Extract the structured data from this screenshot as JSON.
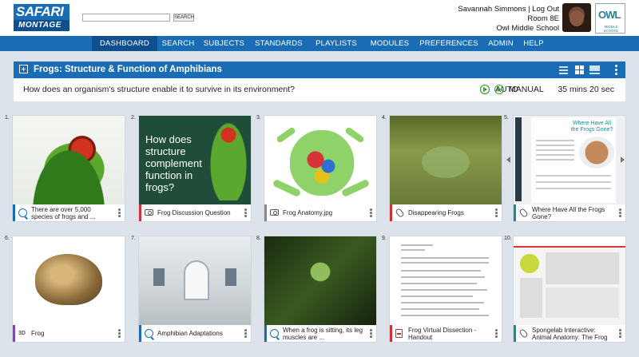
{
  "header": {
    "logo_top": "SAFARI",
    "logo_bottom": "MONTAGE",
    "search_button": "SEARCH",
    "search_placeholder": "",
    "user_line": "Savannah Simmons | Log Out",
    "room": "Room 8E",
    "school": "Owl Middle School",
    "school_logo_main": "OWL",
    "school_logo_sub": "MIDDLE SCHOOL"
  },
  "nav": {
    "items": [
      "DASHBOARD",
      "SEARCH",
      "SUBJECTS",
      "STANDARDS",
      "PLAYLISTS",
      "MODULES",
      "PREFERENCES",
      "ADMIN",
      "HELP"
    ],
    "active": "DASHBOARD"
  },
  "playlist": {
    "title": "Frogs: Structure & Function of Amphibians",
    "question": "How does an organism's structure enable it to survive in its environment?",
    "auto_label": "AUTO",
    "manual_label": "MANUAL",
    "duration": "35 mins 20 sec"
  },
  "cards": [
    {
      "num": "1.",
      "caption": "There are over 5,000 species of frogs and ...",
      "icon": "quiz-icon",
      "color": "#1a6db5"
    },
    {
      "num": "2.",
      "caption": "Frog Discussion Question",
      "icon": "camera-icon",
      "color": "#c33333",
      "thumb_text": "How does structure complement function in frogs?"
    },
    {
      "num": "3.",
      "caption": "Frog Anatomy.jpg",
      "icon": "camera-icon",
      "color": "#888888"
    },
    {
      "num": "4.",
      "caption": "Disappearing Frogs",
      "icon": "link-icon",
      "color": "#c33333"
    },
    {
      "num": "5.",
      "caption": "Where Have All the Frogs Gone?",
      "icon": "link-icon",
      "color": "#1a8aa0",
      "thumb_text": "Where Have All the Frogs Gone?"
    },
    {
      "num": "6.",
      "caption": "Frog",
      "icon": "3d-icon",
      "color": "#7b4aa8"
    },
    {
      "num": "7.",
      "caption": "Amphibian Adaptations",
      "icon": "quiz-icon",
      "color": "#1a6db5"
    },
    {
      "num": "8.",
      "caption": "When a frog is sitting, its leg muscles are ...",
      "icon": "quiz-icon",
      "color": "#1a6db5"
    },
    {
      "num": "9.",
      "caption": "Frog Virtual Dissection - Handout",
      "icon": "pdf-icon",
      "color": "#c33333"
    },
    {
      "num": "10.",
      "caption": "Spongelab Interactive: Animal Anatomy: The Frog",
      "icon": "link-icon",
      "color": "#1a8aa0"
    }
  ],
  "colors": {
    "brand": "#1a6db5",
    "brand_dark": "#0f4f8e",
    "play_green": "#3a9a3a"
  }
}
